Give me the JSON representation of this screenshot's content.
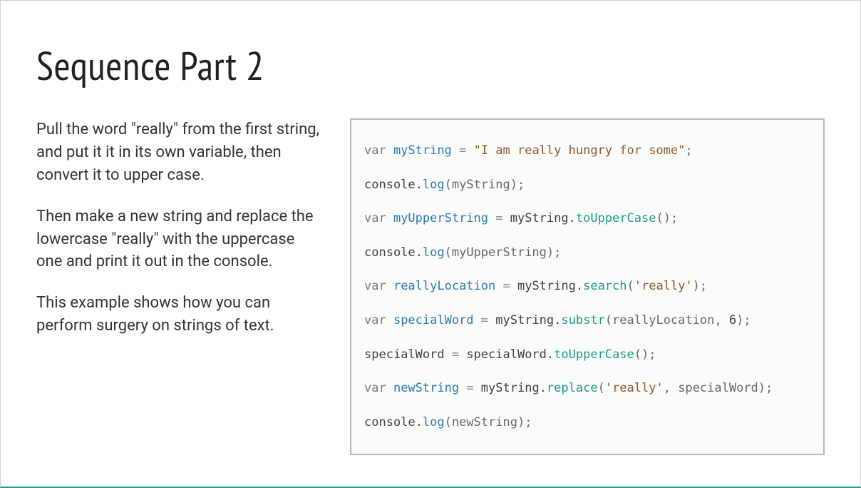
{
  "title": "Sequence Part 2",
  "paragraphs": [
    "Pull the word \"really\" from the first string, and put it it in its own variable, then convert it to upper case.",
    "Then make a new string and replace the lowercase \"really\" with the uppercase one and print it out in the console.",
    "This example shows how you can perform surgery on strings of text."
  ],
  "code": {
    "lines": [
      [
        {
          "t": "var ",
          "c": "kw"
        },
        {
          "t": "myString",
          "c": "nm"
        },
        {
          "t": " = ",
          "c": "op"
        },
        {
          "t": "\"I am really hungry for some\"",
          "c": "str"
        },
        {
          "t": ";",
          "c": "pn"
        }
      ],
      [
        {
          "t": "console.",
          "c": ""
        },
        {
          "t": "log",
          "c": "fn"
        },
        {
          "t": "(myString);",
          "c": "pn"
        }
      ],
      [
        {
          "t": "var ",
          "c": "kw"
        },
        {
          "t": "myUpperString",
          "c": "nm"
        },
        {
          "t": " = ",
          "c": "op"
        },
        {
          "t": "myString.",
          "c": ""
        },
        {
          "t": "toUpperCase",
          "c": "mtd"
        },
        {
          "t": "();",
          "c": "pn"
        }
      ],
      [
        {
          "t": "console.",
          "c": ""
        },
        {
          "t": "log",
          "c": "fn"
        },
        {
          "t": "(myUpperString);",
          "c": "pn"
        }
      ],
      [
        {
          "t": "var ",
          "c": "kw"
        },
        {
          "t": "reallyLocation",
          "c": "nm"
        },
        {
          "t": " = ",
          "c": "op"
        },
        {
          "t": "myString.",
          "c": ""
        },
        {
          "t": "search",
          "c": "mtd"
        },
        {
          "t": "(",
          "c": "pn"
        },
        {
          "t": "'really'",
          "c": "str"
        },
        {
          "t": ");",
          "c": "pn"
        }
      ],
      [
        {
          "t": "var ",
          "c": "kw"
        },
        {
          "t": "specialWord",
          "c": "nm"
        },
        {
          "t": " = ",
          "c": "op"
        },
        {
          "t": "myString.",
          "c": ""
        },
        {
          "t": "substr",
          "c": "mtd"
        },
        {
          "t": "(reallyLocation, ",
          "c": "pn"
        },
        {
          "t": "6",
          "c": ""
        },
        {
          "t": ");",
          "c": "pn"
        }
      ],
      [
        {
          "t": "specialWord",
          "c": ""
        },
        {
          "t": " = ",
          "c": "op"
        },
        {
          "t": "specialWord.",
          "c": ""
        },
        {
          "t": "toUpperCase",
          "c": "mtd"
        },
        {
          "t": "();",
          "c": "pn"
        }
      ],
      [
        {
          "t": "var ",
          "c": "kw"
        },
        {
          "t": "newString",
          "c": "nm"
        },
        {
          "t": " = ",
          "c": "op"
        },
        {
          "t": "myString.",
          "c": ""
        },
        {
          "t": "replace",
          "c": "mtd"
        },
        {
          "t": "(",
          "c": "pn"
        },
        {
          "t": "'really'",
          "c": "str"
        },
        {
          "t": ", specialWord);",
          "c": "pn"
        }
      ],
      [
        {
          "t": "console.",
          "c": ""
        },
        {
          "t": "log",
          "c": "fn"
        },
        {
          "t": "(newString);",
          "c": "pn"
        }
      ]
    ]
  }
}
